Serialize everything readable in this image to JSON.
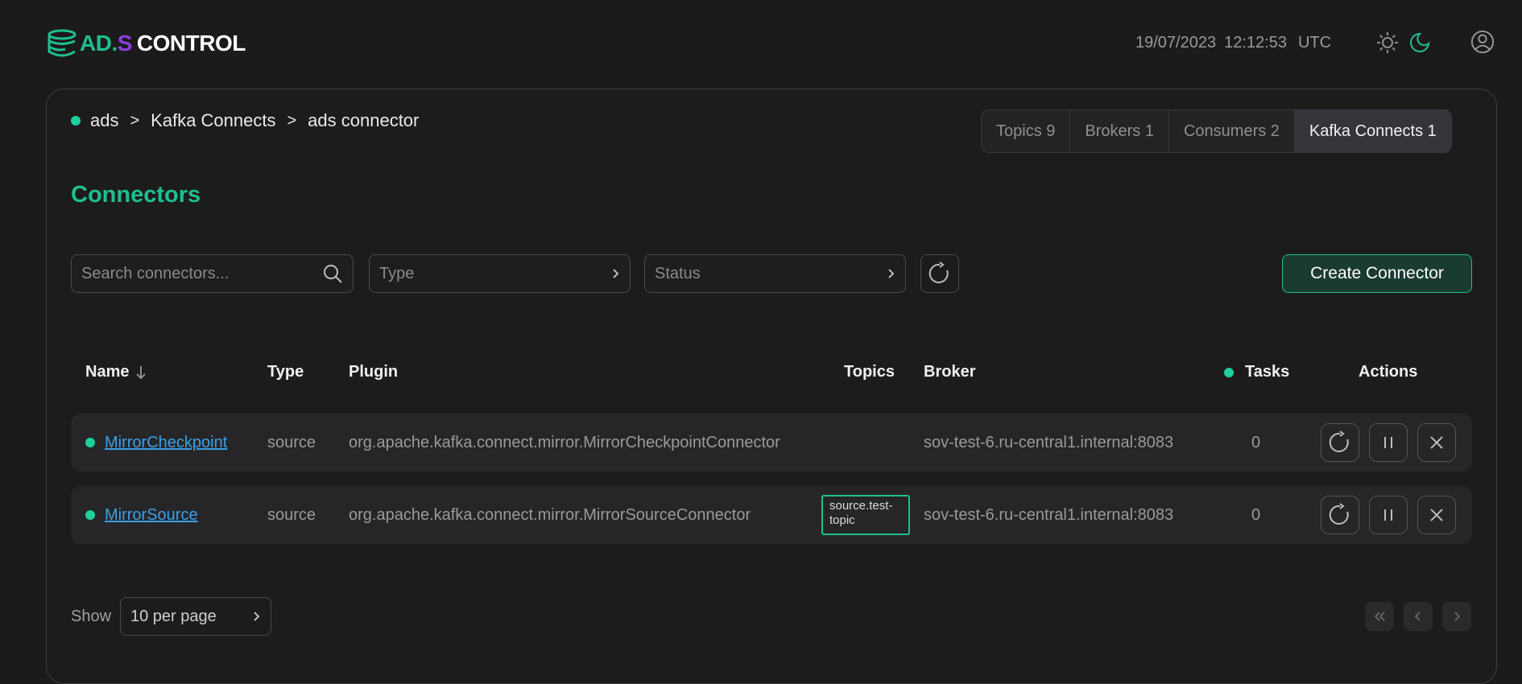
{
  "header": {
    "logo": {
      "ad": "AD",
      "dot": ".",
      "s": "S",
      "control": "CONTROL"
    },
    "date": "19/07/2023",
    "time": "12:12:53",
    "timezone": "UTC"
  },
  "breadcrumb": [
    "ads",
    "Kafka Connects",
    "ads connector"
  ],
  "tabs": [
    {
      "label": "Topics 9",
      "active": false
    },
    {
      "label": "Brokers 1",
      "active": false
    },
    {
      "label": "Consumers 2",
      "active": false
    },
    {
      "label": "Kafka Connects 1",
      "active": true
    }
  ],
  "page_title": "Connectors",
  "filters": {
    "search_placeholder": "Search connectors...",
    "type_placeholder": "Type",
    "status_placeholder": "Status",
    "create_label": "Create Connector"
  },
  "table": {
    "headers": {
      "name": "Name",
      "type": "Type",
      "plugin": "Plugin",
      "topics": "Topics",
      "broker": "Broker",
      "tasks": "Tasks",
      "actions": "Actions"
    },
    "rows": [
      {
        "name": "MirrorCheckpoint",
        "type": "source",
        "plugin": "org.apache.kafka.connect.mirror.MirrorCheckpointConnector",
        "topics": "",
        "broker": "sov-test-6.ru-central1.internal:8083",
        "tasks": "0"
      },
      {
        "name": "MirrorSource",
        "type": "source",
        "plugin": "org.apache.kafka.connect.mirror.MirrorSourceConnector",
        "topics": "source.test-topic",
        "broker": "sov-test-6.ru-central1.internal:8083",
        "tasks": "0"
      }
    ]
  },
  "pagination": {
    "show_label": "Show",
    "per_page": "10 per page"
  },
  "colors": {
    "accent": "#1fbf8f",
    "link": "#3aa0e8",
    "logo_s": "#8a3fe0"
  }
}
